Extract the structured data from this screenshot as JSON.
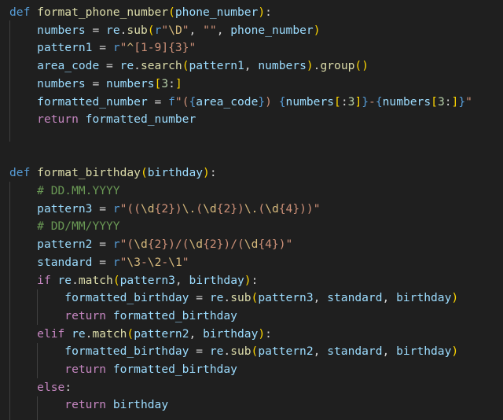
{
  "lines": [
    {
      "tokens": [
        [
          "kw",
          "def "
        ],
        [
          "fn",
          "format_phone_number"
        ],
        [
          "br1",
          "("
        ],
        [
          "var",
          "phone_number"
        ],
        [
          "br1",
          ")"
        ],
        [
          "op",
          ":"
        ]
      ]
    },
    {
      "tokens": [
        [
          "op",
          "    "
        ],
        [
          "var",
          "numbers"
        ],
        [
          "op",
          " = "
        ],
        [
          "var",
          "re"
        ],
        [
          "op",
          "."
        ],
        [
          "fn",
          "sub"
        ],
        [
          "br1",
          "("
        ],
        [
          "kw",
          "r"
        ],
        [
          "str",
          "\""
        ],
        [
          "esc",
          "\\D"
        ],
        [
          "str",
          "\""
        ],
        [
          "op",
          ", "
        ],
        [
          "str",
          "\"\""
        ],
        [
          "op",
          ", "
        ],
        [
          "var",
          "phone_number"
        ],
        [
          "br1",
          ")"
        ]
      ]
    },
    {
      "tokens": [
        [
          "op",
          "    "
        ],
        [
          "var",
          "pattern1"
        ],
        [
          "op",
          " = "
        ],
        [
          "kw",
          "r"
        ],
        [
          "str",
          "\""
        ],
        [
          "esc",
          "^"
        ],
        [
          "str",
          "[1-9]{3}"
        ],
        [
          "str",
          "\""
        ]
      ]
    },
    {
      "tokens": [
        [
          "op",
          "    "
        ],
        [
          "var",
          "area_code"
        ],
        [
          "op",
          " = "
        ],
        [
          "var",
          "re"
        ],
        [
          "op",
          "."
        ],
        [
          "fn",
          "search"
        ],
        [
          "br1",
          "("
        ],
        [
          "var",
          "pattern1"
        ],
        [
          "op",
          ", "
        ],
        [
          "var",
          "numbers"
        ],
        [
          "br1",
          ")"
        ],
        [
          "op",
          "."
        ],
        [
          "fn",
          "group"
        ],
        [
          "br1",
          "()"
        ]
      ]
    },
    {
      "tokens": [
        [
          "op",
          "    "
        ],
        [
          "var",
          "numbers"
        ],
        [
          "op",
          " = "
        ],
        [
          "var",
          "numbers"
        ],
        [
          "br1",
          "["
        ],
        [
          "num",
          "3"
        ],
        [
          "op",
          ":"
        ],
        [
          "br1",
          "]"
        ]
      ]
    },
    {
      "tokens": [
        [
          "op",
          "    "
        ],
        [
          "var",
          "formatted_number"
        ],
        [
          "op",
          " = "
        ],
        [
          "kw",
          "f"
        ],
        [
          "str",
          "\"("
        ],
        [
          "kw",
          "{"
        ],
        [
          "var",
          "area_code"
        ],
        [
          "kw",
          "}"
        ],
        [
          "str",
          ") "
        ],
        [
          "kw",
          "{"
        ],
        [
          "var",
          "numbers"
        ],
        [
          "br1",
          "["
        ],
        [
          "op",
          ":"
        ],
        [
          "num",
          "3"
        ],
        [
          "br1",
          "]"
        ],
        [
          "kw",
          "}"
        ],
        [
          "str",
          "-"
        ],
        [
          "kw",
          "{"
        ],
        [
          "var",
          "numbers"
        ],
        [
          "br1",
          "["
        ],
        [
          "num",
          "3"
        ],
        [
          "op",
          ":"
        ],
        [
          "br1",
          "]"
        ],
        [
          "kw",
          "}"
        ],
        [
          "str",
          "\""
        ]
      ]
    },
    {
      "tokens": [
        [
          "op",
          "    "
        ],
        [
          "ctl",
          "return "
        ],
        [
          "var",
          "formatted_number"
        ]
      ]
    },
    {
      "tokens": []
    },
    {
      "tokens": []
    },
    {
      "tokens": [
        [
          "kw",
          "def "
        ],
        [
          "fn",
          "format_birthday"
        ],
        [
          "br1",
          "("
        ],
        [
          "var",
          "birthday"
        ],
        [
          "br1",
          ")"
        ],
        [
          "op",
          ":"
        ]
      ]
    },
    {
      "tokens": [
        [
          "op",
          "    "
        ],
        [
          "cmt",
          "# DD.MM.YYYY"
        ]
      ]
    },
    {
      "tokens": [
        [
          "op",
          "    "
        ],
        [
          "var",
          "pattern3"
        ],
        [
          "op",
          " = "
        ],
        [
          "kw",
          "r"
        ],
        [
          "str",
          "\"(("
        ],
        [
          "esc",
          "\\d"
        ],
        [
          "str",
          "{2})"
        ],
        [
          "esc",
          "\\."
        ],
        [
          "str",
          "("
        ],
        [
          "esc",
          "\\d"
        ],
        [
          "str",
          "{2})"
        ],
        [
          "esc",
          "\\."
        ],
        [
          "str",
          "("
        ],
        [
          "esc",
          "\\d"
        ],
        [
          "str",
          "{4}))\""
        ]
      ]
    },
    {
      "tokens": [
        [
          "op",
          "    "
        ],
        [
          "cmt",
          "# DD/MM/YYYY"
        ]
      ]
    },
    {
      "tokens": [
        [
          "op",
          "    "
        ],
        [
          "var",
          "pattern2"
        ],
        [
          "op",
          " = "
        ],
        [
          "kw",
          "r"
        ],
        [
          "str",
          "\"("
        ],
        [
          "esc",
          "\\d"
        ],
        [
          "str",
          "{2})/("
        ],
        [
          "esc",
          "\\d"
        ],
        [
          "str",
          "{2})/("
        ],
        [
          "esc",
          "\\d"
        ],
        [
          "str",
          "{4})\""
        ]
      ]
    },
    {
      "tokens": [
        [
          "op",
          "    "
        ],
        [
          "var",
          "standard"
        ],
        [
          "op",
          " = "
        ],
        [
          "kw",
          "r"
        ],
        [
          "str",
          "\""
        ],
        [
          "esc",
          "\\3"
        ],
        [
          "str",
          "-"
        ],
        [
          "esc",
          "\\2"
        ],
        [
          "str",
          "-"
        ],
        [
          "esc",
          "\\1"
        ],
        [
          "str",
          "\""
        ]
      ]
    },
    {
      "tokens": [
        [
          "op",
          "    "
        ],
        [
          "ctl",
          "if "
        ],
        [
          "var",
          "re"
        ],
        [
          "op",
          "."
        ],
        [
          "fn",
          "match"
        ],
        [
          "br1",
          "("
        ],
        [
          "var",
          "pattern3"
        ],
        [
          "op",
          ", "
        ],
        [
          "var",
          "birthday"
        ],
        [
          "br1",
          ")"
        ],
        [
          "op",
          ":"
        ]
      ]
    },
    {
      "tokens": [
        [
          "op",
          "        "
        ],
        [
          "var",
          "formatted_birthday"
        ],
        [
          "op",
          " = "
        ],
        [
          "var",
          "re"
        ],
        [
          "op",
          "."
        ],
        [
          "fn",
          "sub"
        ],
        [
          "br1",
          "("
        ],
        [
          "var",
          "pattern3"
        ],
        [
          "op",
          ", "
        ],
        [
          "var",
          "standard"
        ],
        [
          "op",
          ", "
        ],
        [
          "var",
          "birthday"
        ],
        [
          "br1",
          ")"
        ]
      ]
    },
    {
      "tokens": [
        [
          "op",
          "        "
        ],
        [
          "ctl",
          "return "
        ],
        [
          "var",
          "formatted_birthday"
        ]
      ]
    },
    {
      "tokens": [
        [
          "op",
          "    "
        ],
        [
          "ctl",
          "elif "
        ],
        [
          "var",
          "re"
        ],
        [
          "op",
          "."
        ],
        [
          "fn",
          "match"
        ],
        [
          "br1",
          "("
        ],
        [
          "var",
          "pattern2"
        ],
        [
          "op",
          ", "
        ],
        [
          "var",
          "birthday"
        ],
        [
          "br1",
          ")"
        ],
        [
          "op",
          ":"
        ]
      ]
    },
    {
      "tokens": [
        [
          "op",
          "        "
        ],
        [
          "var",
          "formatted_birthday"
        ],
        [
          "op",
          " = "
        ],
        [
          "var",
          "re"
        ],
        [
          "op",
          "."
        ],
        [
          "fn",
          "sub"
        ],
        [
          "br1",
          "("
        ],
        [
          "var",
          "pattern2"
        ],
        [
          "op",
          ", "
        ],
        [
          "var",
          "standard"
        ],
        [
          "op",
          ", "
        ],
        [
          "var",
          "birthday"
        ],
        [
          "br1",
          ")"
        ]
      ]
    },
    {
      "tokens": [
        [
          "op",
          "        "
        ],
        [
          "ctl",
          "return "
        ],
        [
          "var",
          "formatted_birthday"
        ]
      ]
    },
    {
      "tokens": [
        [
          "op",
          "    "
        ],
        [
          "ctl",
          "else"
        ],
        [
          "op",
          ":"
        ]
      ]
    },
    {
      "tokens": [
        [
          "op",
          "        "
        ],
        [
          "ctl",
          "return "
        ],
        [
          "var",
          "birthday"
        ]
      ]
    }
  ]
}
